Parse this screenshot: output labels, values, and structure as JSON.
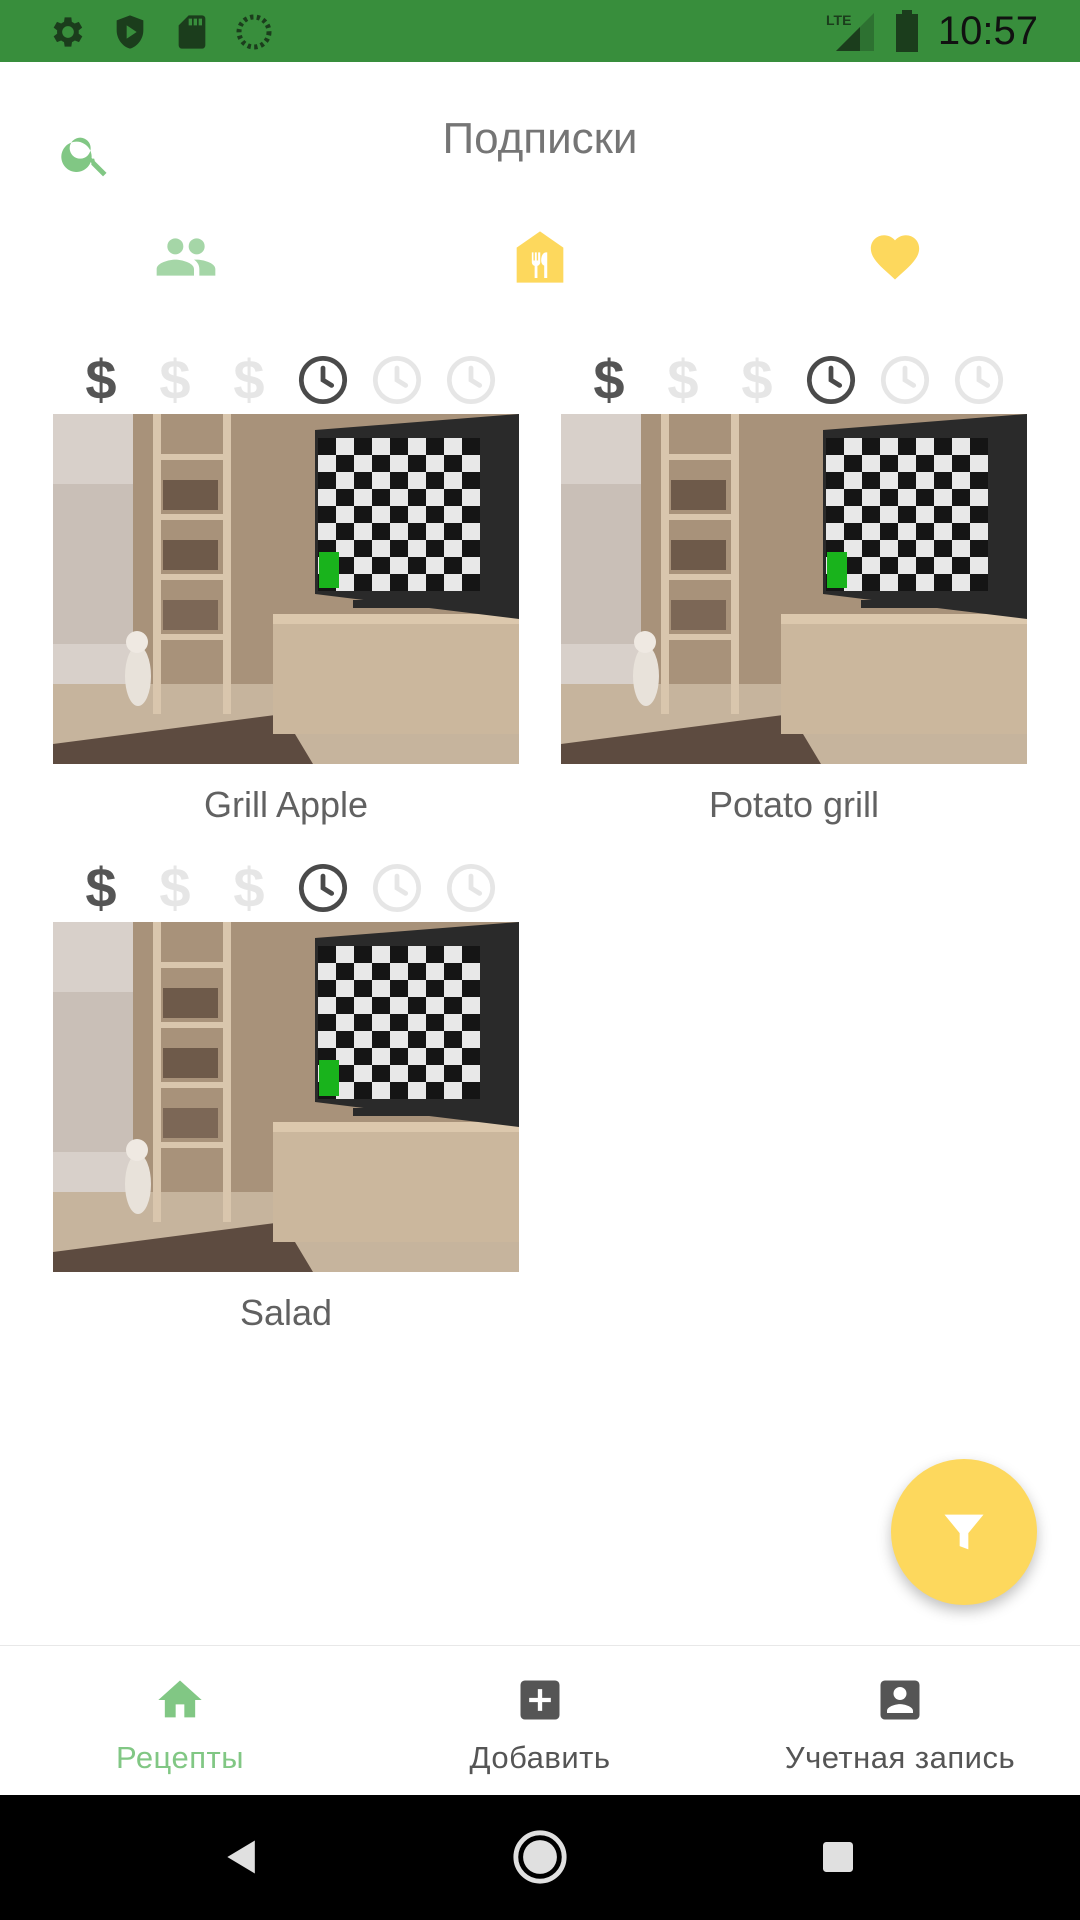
{
  "status_bar": {
    "time": "10:57",
    "network": "LTE"
  },
  "header": {
    "title": "Подписки"
  },
  "tabs": [
    {
      "icon": "people-icon",
      "color": "#a5d6a7"
    },
    {
      "icon": "restaurant-icon",
      "color": "#fdd85d"
    },
    {
      "icon": "heart-icon",
      "color": "#fdd85d"
    }
  ],
  "recipes": [
    {
      "title": "Grill Apple",
      "price_level": 1,
      "price_max": 3,
      "time_level": 1,
      "time_max": 3
    },
    {
      "title": "Potato grill",
      "price_level": 1,
      "price_max": 3,
      "time_level": 1,
      "time_max": 3
    },
    {
      "title": "Salad",
      "price_level": 1,
      "price_max": 3,
      "time_level": 1,
      "time_max": 3
    }
  ],
  "rating_symbols": {
    "price": "$"
  },
  "fab": {
    "icon": "filter-icon",
    "color": "#fdd85d"
  },
  "bottom_nav": [
    {
      "label": "Рецепты",
      "icon": "home-icon",
      "active": true
    },
    {
      "label": "Добавить",
      "icon": "add-box-icon",
      "active": false
    },
    {
      "label": "Учетная запись",
      "icon": "account-box-icon",
      "active": false
    }
  ],
  "colors": {
    "status_bar": "#388e3c",
    "accent_green": "#81c784",
    "accent_yellow": "#fdd85d",
    "icon_active": "#555555",
    "icon_inactive": "#e6e6e6",
    "text_gray": "#616161"
  }
}
